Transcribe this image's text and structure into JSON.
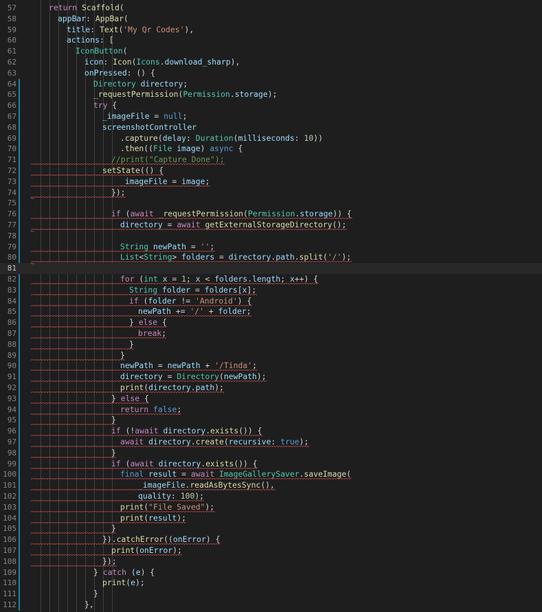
{
  "editor": {
    "current_line": 81,
    "lines": [
      {
        "n": 57,
        "tokens": [
          [
            "ctl",
            "return"
          ],
          [
            "pun",
            " "
          ],
          [
            "fn",
            "Scaffold"
          ],
          [
            "pun",
            "("
          ]
        ]
      },
      {
        "n": 58,
        "tokens": [
          [
            "var",
            "appBar"
          ],
          [
            "pun",
            ": "
          ],
          [
            "fn",
            "AppBar"
          ],
          [
            "pun",
            "("
          ]
        ]
      },
      {
        "n": 59,
        "tokens": [
          [
            "var",
            "title"
          ],
          [
            "pun",
            ": "
          ],
          [
            "fn",
            "Text"
          ],
          [
            "pun",
            "("
          ],
          [
            "str",
            "'My Qr Codes'"
          ],
          [
            "pun",
            "),"
          ]
        ]
      },
      {
        "n": 60,
        "tokens": [
          [
            "var",
            "actions"
          ],
          [
            "pun",
            ": ["
          ]
        ]
      },
      {
        "n": 61,
        "tokens": [
          [
            "ty",
            "IconButton"
          ],
          [
            "pun",
            "("
          ]
        ]
      },
      {
        "n": 62,
        "tokens": [
          [
            "var",
            "icon"
          ],
          [
            "pun",
            ": "
          ],
          [
            "fn",
            "Icon"
          ],
          [
            "pun",
            "("
          ],
          [
            "ty",
            "Icons"
          ],
          [
            "pun",
            "."
          ],
          [
            "var",
            "download_sharp"
          ],
          [
            "pun",
            "),"
          ]
        ]
      },
      {
        "n": 63,
        "tokens": [
          [
            "var",
            "onPressed"
          ],
          [
            "pun",
            ": () {"
          ]
        ]
      },
      {
        "n": 64,
        "tokens": [
          [
            "ty",
            "Directory"
          ],
          [
            "pun",
            " "
          ],
          [
            "var",
            "directory"
          ],
          [
            "pun",
            ";"
          ]
        ]
      },
      {
        "n": 65,
        "tokens": [
          [
            "fn",
            "_requestPermission"
          ],
          [
            "pun",
            "("
          ],
          [
            "ty",
            "Permission"
          ],
          [
            "pun",
            "."
          ],
          [
            "var",
            "storage"
          ],
          [
            "pun",
            ");"
          ]
        ]
      },
      {
        "n": 66,
        "tokens": [
          [
            "ctl",
            "try"
          ],
          [
            "pun",
            " {"
          ]
        ]
      },
      {
        "n": 67,
        "tokens": [
          [
            "var",
            "_imageFile"
          ],
          [
            "pun",
            " = "
          ],
          [
            "kw",
            "null"
          ],
          [
            "pun",
            ";"
          ]
        ]
      },
      {
        "n": 68,
        "tokens": [
          [
            "var",
            "screenshotController"
          ]
        ]
      },
      {
        "n": 69,
        "tokens": [
          [
            "pun",
            "."
          ],
          [
            "fn",
            "capture"
          ],
          [
            "pun",
            "("
          ],
          [
            "var",
            "delay"
          ],
          [
            "pun",
            ": "
          ],
          [
            "ty",
            "Duration"
          ],
          [
            "pun",
            "("
          ],
          [
            "var",
            "milliseconds"
          ],
          [
            "pun",
            ": "
          ],
          [
            "num",
            "10"
          ],
          [
            "pun",
            "))"
          ]
        ]
      },
      {
        "n": 70,
        "tokens": [
          [
            "pun",
            "."
          ],
          [
            "fn",
            "then"
          ],
          [
            "pun",
            "(("
          ],
          [
            "ty",
            "File"
          ],
          [
            "pun",
            " "
          ],
          [
            "var",
            "image"
          ],
          [
            "pun",
            ") "
          ],
          [
            "kw",
            "async"
          ],
          [
            "pun",
            " {"
          ]
        ]
      },
      {
        "n": 71,
        "tokens": [
          [
            "com",
            "//print(\"Capture Done\");"
          ]
        ]
      },
      {
        "n": 72,
        "tokens": [
          [
            "fn",
            "setState"
          ],
          [
            "pun",
            "(() {"
          ]
        ]
      },
      {
        "n": 73,
        "tokens": [
          [
            "var",
            "_imageFile"
          ],
          [
            "pun",
            " = "
          ],
          [
            "var",
            "image"
          ],
          [
            "pun",
            ";"
          ]
        ]
      },
      {
        "n": 74,
        "tokens": [
          [
            "pun",
            "});"
          ]
        ]
      },
      {
        "n": 75,
        "tokens": []
      },
      {
        "n": 76,
        "tokens": [
          [
            "ctl",
            "if"
          ],
          [
            "pun",
            " ("
          ],
          [
            "ctl",
            "await"
          ],
          [
            "pun",
            " "
          ],
          [
            "fn",
            "_requestPermission"
          ],
          [
            "pun",
            "("
          ],
          [
            "ty",
            "Permission"
          ],
          [
            "pun",
            "."
          ],
          [
            "var",
            "storage"
          ],
          [
            "pun",
            ")) {"
          ]
        ]
      },
      {
        "n": 77,
        "tokens": [
          [
            "var",
            "directory"
          ],
          [
            "pun",
            " = "
          ],
          [
            "ctl",
            "await"
          ],
          [
            "pun",
            " "
          ],
          [
            "fn",
            "getExternalStorageDirectory"
          ],
          [
            "pun",
            "();"
          ]
        ]
      },
      {
        "n": 78,
        "tokens": []
      },
      {
        "n": 79,
        "tokens": [
          [
            "ty",
            "String"
          ],
          [
            "pun",
            " "
          ],
          [
            "var",
            "newPath"
          ],
          [
            "pun",
            " = "
          ],
          [
            "str",
            "''"
          ],
          [
            "pun",
            ";"
          ]
        ]
      },
      {
        "n": 80,
        "tokens": [
          [
            "ty",
            "List"
          ],
          [
            "pun",
            "<"
          ],
          [
            "ty",
            "String"
          ],
          [
            "pun",
            "> "
          ],
          [
            "var",
            "folders"
          ],
          [
            "pun",
            " = "
          ],
          [
            "var",
            "directory"
          ],
          [
            "pun",
            "."
          ],
          [
            "var",
            "path"
          ],
          [
            "pun",
            "."
          ],
          [
            "fn",
            "split"
          ],
          [
            "pun",
            "("
          ],
          [
            "str",
            "'/'"
          ],
          [
            "pun",
            ");"
          ]
        ]
      },
      {
        "n": 81,
        "tokens": []
      },
      {
        "n": 82,
        "tokens": [
          [
            "ctl",
            "for"
          ],
          [
            "pun",
            " ("
          ],
          [
            "ty",
            "int"
          ],
          [
            "pun",
            " "
          ],
          [
            "var",
            "x"
          ],
          [
            "pun",
            " = "
          ],
          [
            "num",
            "1"
          ],
          [
            "pun",
            "; "
          ],
          [
            "var",
            "x"
          ],
          [
            "pun",
            " < "
          ],
          [
            "var",
            "folders"
          ],
          [
            "pun",
            "."
          ],
          [
            "var",
            "length"
          ],
          [
            "pun",
            "; "
          ],
          [
            "var",
            "x"
          ],
          [
            "pun",
            "++) {"
          ]
        ]
      },
      {
        "n": 83,
        "tokens": [
          [
            "ty",
            "String"
          ],
          [
            "pun",
            " "
          ],
          [
            "var",
            "folder"
          ],
          [
            "pun",
            " = "
          ],
          [
            "var",
            "folders"
          ],
          [
            "pun",
            "["
          ],
          [
            "var",
            "x"
          ],
          [
            "pun",
            "];"
          ]
        ]
      },
      {
        "n": 84,
        "tokens": [
          [
            "ctl",
            "if"
          ],
          [
            "pun",
            " ("
          ],
          [
            "var",
            "folder"
          ],
          [
            "pun",
            " != "
          ],
          [
            "str",
            "'Android'"
          ],
          [
            "pun",
            ") {"
          ]
        ]
      },
      {
        "n": 85,
        "tokens": [
          [
            "var",
            "newPath"
          ],
          [
            "pun",
            " += "
          ],
          [
            "str",
            "'/'"
          ],
          [
            "pun",
            " + "
          ],
          [
            "var",
            "folder"
          ],
          [
            "pun",
            ";"
          ]
        ]
      },
      {
        "n": 86,
        "tokens": [
          [
            "pun",
            "} "
          ],
          [
            "ctl",
            "else"
          ],
          [
            "pun",
            " {"
          ]
        ]
      },
      {
        "n": 87,
        "tokens": [
          [
            "ctl",
            "break"
          ],
          [
            "pun",
            ";"
          ]
        ]
      },
      {
        "n": 88,
        "tokens": [
          [
            "pun",
            "}"
          ]
        ]
      },
      {
        "n": 89,
        "tokens": [
          [
            "pun",
            "}"
          ]
        ]
      },
      {
        "n": 90,
        "tokens": [
          [
            "var",
            "newPath"
          ],
          [
            "pun",
            " = "
          ],
          [
            "var",
            "newPath"
          ],
          [
            "pun",
            " + "
          ],
          [
            "str",
            "'/Tinda'"
          ],
          [
            "pun",
            ";"
          ]
        ]
      },
      {
        "n": 91,
        "tokens": [
          [
            "var",
            "directory"
          ],
          [
            "pun",
            " = "
          ],
          [
            "ty",
            "Directory"
          ],
          [
            "pun",
            "("
          ],
          [
            "var",
            "newPath"
          ],
          [
            "pun",
            ");"
          ]
        ]
      },
      {
        "n": 92,
        "tokens": [
          [
            "fn",
            "print"
          ],
          [
            "pun",
            "("
          ],
          [
            "var",
            "directory"
          ],
          [
            "pun",
            "."
          ],
          [
            "var",
            "path"
          ],
          [
            "pun",
            ");"
          ]
        ]
      },
      {
        "n": 93,
        "tokens": [
          [
            "pun",
            "} "
          ],
          [
            "ctl",
            "else"
          ],
          [
            "pun",
            " {"
          ]
        ]
      },
      {
        "n": 94,
        "tokens": [
          [
            "ctl",
            "return"
          ],
          [
            "pun",
            " "
          ],
          [
            "kw",
            "false"
          ],
          [
            "pun",
            ";"
          ]
        ]
      },
      {
        "n": 95,
        "tokens": [
          [
            "pun",
            "}"
          ]
        ]
      },
      {
        "n": 96,
        "tokens": [
          [
            "ctl",
            "if"
          ],
          [
            "pun",
            " (!"
          ],
          [
            "ctl",
            "await"
          ],
          [
            "pun",
            " "
          ],
          [
            "var",
            "directory"
          ],
          [
            "pun",
            "."
          ],
          [
            "fn",
            "exists"
          ],
          [
            "pun",
            "()) {"
          ]
        ]
      },
      {
        "n": 97,
        "tokens": [
          [
            "ctl",
            "await"
          ],
          [
            "pun",
            " "
          ],
          [
            "var",
            "directory"
          ],
          [
            "pun",
            "."
          ],
          [
            "fn",
            "create"
          ],
          [
            "pun",
            "("
          ],
          [
            "var",
            "recursive"
          ],
          [
            "pun",
            ": "
          ],
          [
            "kw",
            "true"
          ],
          [
            "pun",
            ");"
          ]
        ]
      },
      {
        "n": 98,
        "tokens": [
          [
            "pun",
            "}"
          ]
        ]
      },
      {
        "n": 99,
        "tokens": [
          [
            "ctl",
            "if"
          ],
          [
            "pun",
            " ("
          ],
          [
            "ctl",
            "await"
          ],
          [
            "pun",
            " "
          ],
          [
            "var",
            "directory"
          ],
          [
            "pun",
            "."
          ],
          [
            "fn",
            "exists"
          ],
          [
            "pun",
            "()) {"
          ]
        ]
      },
      {
        "n": 100,
        "tokens": [
          [
            "kw",
            "final"
          ],
          [
            "pun",
            " "
          ],
          [
            "var",
            "result"
          ],
          [
            "pun",
            " = "
          ],
          [
            "ctl",
            "await"
          ],
          [
            "pun",
            " "
          ],
          [
            "ty",
            "ImageGallerySaver"
          ],
          [
            "pun",
            "."
          ],
          [
            "fn",
            "saveImage"
          ],
          [
            "pun",
            "("
          ]
        ]
      },
      {
        "n": 101,
        "tokens": [
          [
            "var",
            "_imageFile"
          ],
          [
            "pun",
            "."
          ],
          [
            "fn",
            "readAsBytesSync"
          ],
          [
            "pun",
            "(),"
          ]
        ]
      },
      {
        "n": 102,
        "tokens": [
          [
            "var",
            "quality"
          ],
          [
            "pun",
            ": "
          ],
          [
            "num",
            "100"
          ],
          [
            "pun",
            ");"
          ]
        ]
      },
      {
        "n": 103,
        "tokens": [
          [
            "fn",
            "print"
          ],
          [
            "pun",
            "("
          ],
          [
            "str",
            "\"File Saved\""
          ],
          [
            "pun",
            ");"
          ]
        ]
      },
      {
        "n": 104,
        "tokens": [
          [
            "fn",
            "print"
          ],
          [
            "pun",
            "("
          ],
          [
            "var",
            "result"
          ],
          [
            "pun",
            ");"
          ]
        ]
      },
      {
        "n": 105,
        "tokens": [
          [
            "pun",
            "}"
          ]
        ]
      },
      {
        "n": 106,
        "tokens": [
          [
            "pun",
            "})."
          ],
          [
            "fn",
            "catchError"
          ],
          [
            "pun",
            "(("
          ],
          [
            "var",
            "onError"
          ],
          [
            "pun",
            ") {"
          ]
        ]
      },
      {
        "n": 107,
        "tokens": [
          [
            "fn",
            "print"
          ],
          [
            "pun",
            "("
          ],
          [
            "var",
            "onError"
          ],
          [
            "pun",
            ");"
          ]
        ]
      },
      {
        "n": 108,
        "tokens": [
          [
            "pun",
            "});"
          ]
        ]
      },
      {
        "n": 109,
        "tokens": [
          [
            "pun",
            "} "
          ],
          [
            "ctl",
            "catch"
          ],
          [
            "pun",
            " ("
          ],
          [
            "var",
            "e"
          ],
          [
            "pun",
            ") {"
          ]
        ]
      },
      {
        "n": 110,
        "tokens": [
          [
            "fn",
            "print"
          ],
          [
            "pun",
            "("
          ],
          [
            "var",
            "e"
          ],
          [
            "pun",
            ");"
          ]
        ]
      },
      {
        "n": 111,
        "tokens": [
          [
            "pun",
            "}"
          ]
        ]
      },
      {
        "n": 112,
        "tokens": [
          [
            "pun",
            "},"
          ]
        ]
      }
    ]
  }
}
